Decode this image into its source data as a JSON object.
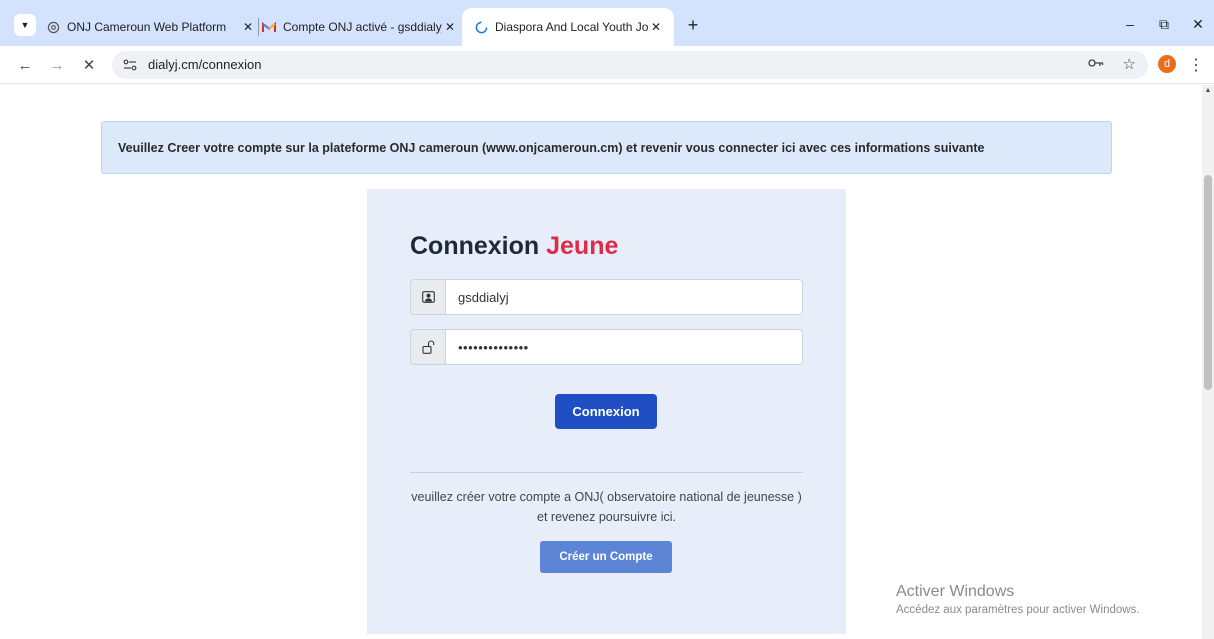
{
  "browser": {
    "tabs": [
      {
        "title": "ONJ Cameroun Web Platform",
        "favicon": "globe-icon",
        "active": false
      },
      {
        "title": "Compte ONJ activé - gsddialyj@",
        "favicon": "gmail-icon",
        "active": false
      },
      {
        "title": "Diaspora And Local Youth Joint",
        "favicon": "loading-spinner-icon",
        "active": true
      }
    ],
    "tab_close_glyph": "✕",
    "new_tab_glyph": "+",
    "url": "dialyj.cm/connexion",
    "profile_initial": "d",
    "window_controls": {
      "minimize": "–",
      "restore": "⧉",
      "close": "✕"
    }
  },
  "alert": {
    "text": "Veuillez Creer votre compte sur la plateforme ONJ cameroun (www.onjcameroun.cm) et revenir vous connecter ici avec ces informations suivante"
  },
  "login": {
    "title_main": "Connexion",
    "title_accent": "Jeune",
    "username_value": "gsddialyj",
    "password_value": "••••••••••••••",
    "submit_label": "Connexion",
    "info_text": "veuillez créer votre compte a ONJ( observatoire national de jeunesse ) et revenez poursuivre ici.",
    "create_account_label": "Créer un Compte"
  },
  "watermark": {
    "title": "Activer Windows",
    "subtitle": "Accédez aux paramètres pour activer Windows."
  },
  "colors": {
    "accent_red": "#dc2c4a",
    "primary_button": "#1f4fc2",
    "secondary_button": "#5d85d6",
    "alert_background": "#dce9fb",
    "card_background": "#e7eefa"
  }
}
